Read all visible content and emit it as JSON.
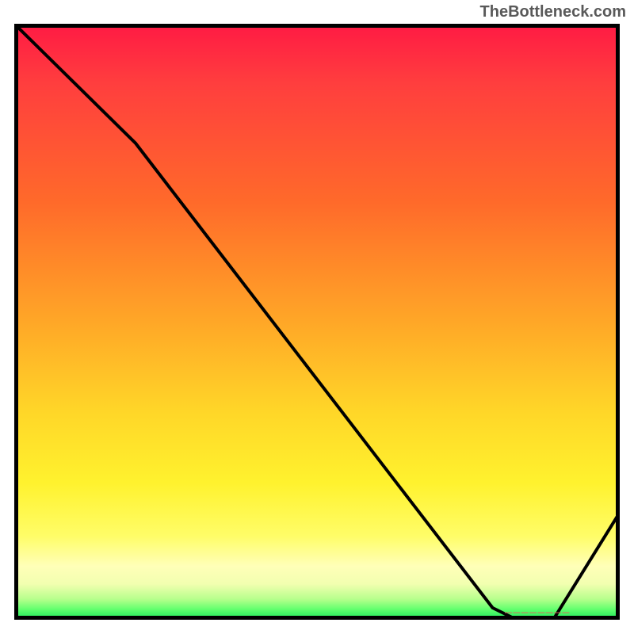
{
  "watermark": "TheBottleneck.com",
  "flat_marker_label": "────────",
  "colors": {
    "watermark_text": "#595959",
    "curve_stroke": "#000000",
    "flat_marker": "#e85a5a",
    "gradient_top": "#ff1a44",
    "gradient_bottom": "#17e85a"
  },
  "chart_data": {
    "type": "line",
    "title": "",
    "xlabel": "",
    "ylabel": "",
    "xlim": [
      0,
      100
    ],
    "ylim": [
      0,
      100
    ],
    "series": [
      {
        "name": "bottleneck-curve",
        "x": [
          0,
          20,
          79,
          83,
          89,
          100
        ],
        "values": [
          100,
          80,
          2,
          0,
          0,
          18
        ]
      }
    ],
    "annotations": [
      {
        "name": "optimal-flat-region",
        "x_start": 83,
        "x_end": 89,
        "y": 0.5
      }
    ],
    "background_gradient": {
      "direction": "vertical",
      "stops": [
        {
          "pos": 0.0,
          "color": "#ff1a44"
        },
        {
          "pos": 0.1,
          "color": "#ff3e3e"
        },
        {
          "pos": 0.3,
          "color": "#ff6a2a"
        },
        {
          "pos": 0.5,
          "color": "#ffa727"
        },
        {
          "pos": 0.65,
          "color": "#ffd628"
        },
        {
          "pos": 0.77,
          "color": "#fff22e"
        },
        {
          "pos": 0.86,
          "color": "#fffd68"
        },
        {
          "pos": 0.91,
          "color": "#ffffb8"
        },
        {
          "pos": 0.94,
          "color": "#f2ffb0"
        },
        {
          "pos": 0.965,
          "color": "#b8ff8d"
        },
        {
          "pos": 0.983,
          "color": "#5fff6d"
        },
        {
          "pos": 1.0,
          "color": "#17e85a"
        }
      ]
    }
  }
}
